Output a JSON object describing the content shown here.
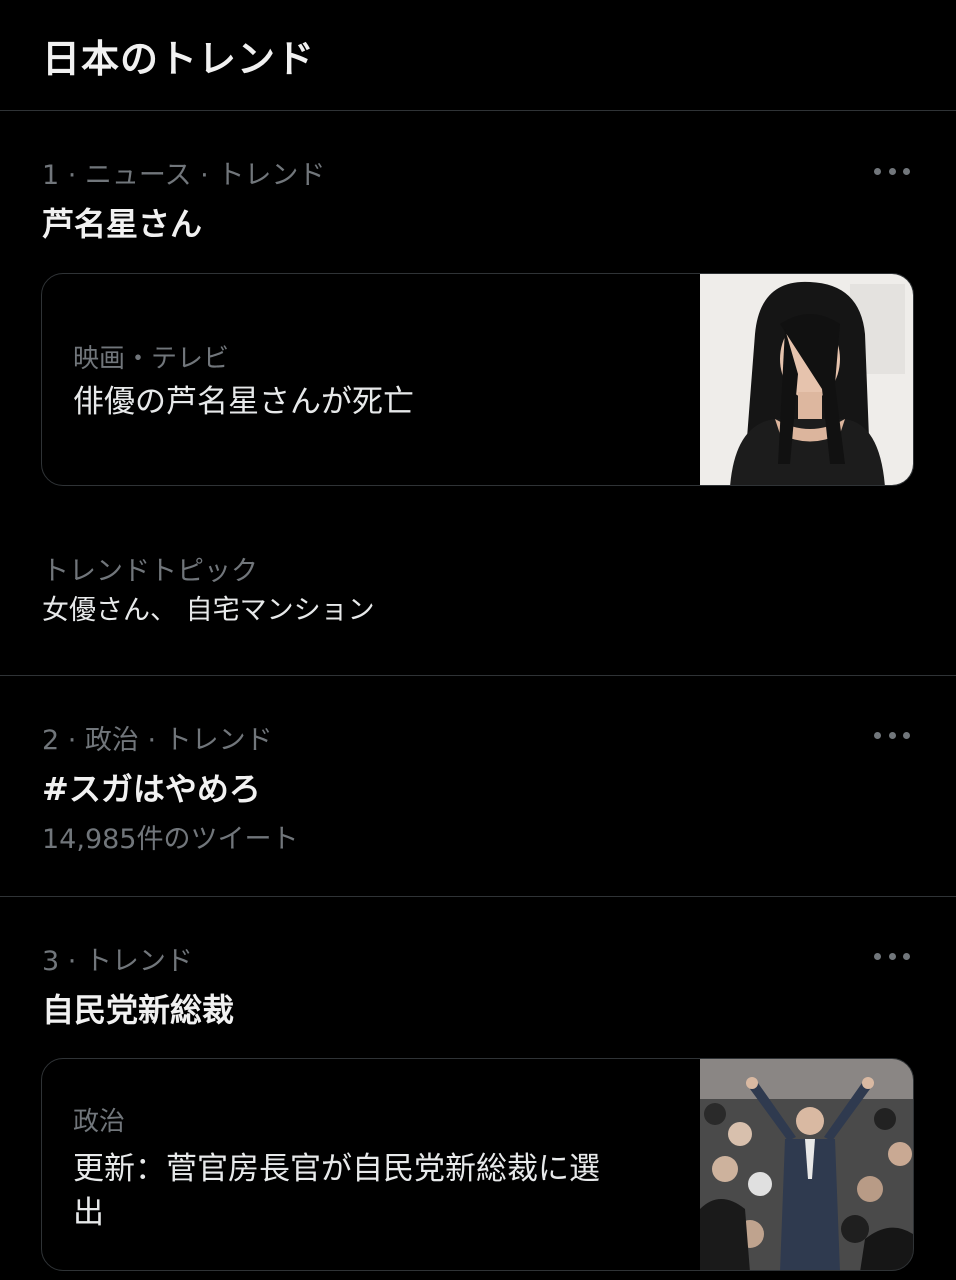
{
  "header": {
    "title": "日本のトレンド"
  },
  "trends": [
    {
      "meta": "1 · ニュース · トレンド",
      "name": "芦名星さん",
      "card": {
        "category": "映画・テレビ",
        "headline": "俳優の芦名星さんが死亡"
      },
      "topic_label": "トレンドトピック",
      "topic_value": "女優さん、 自宅マンション"
    },
    {
      "meta": "2 · 政治 · トレンド",
      "name": "#スガはやめろ",
      "count": "14,985件のツイート"
    },
    {
      "meta": "3 · トレンド",
      "name": "自民党新総裁",
      "card": {
        "category": "政治",
        "headline": "更新：菅官房長官が自民党新総裁に選出"
      }
    }
  ],
  "icons": {
    "more": "more-horizontal-icon"
  },
  "colors": {
    "background": "#000000",
    "text": "#e7e9ea",
    "secondary_text": "#71767b",
    "divider": "#2f3336"
  }
}
